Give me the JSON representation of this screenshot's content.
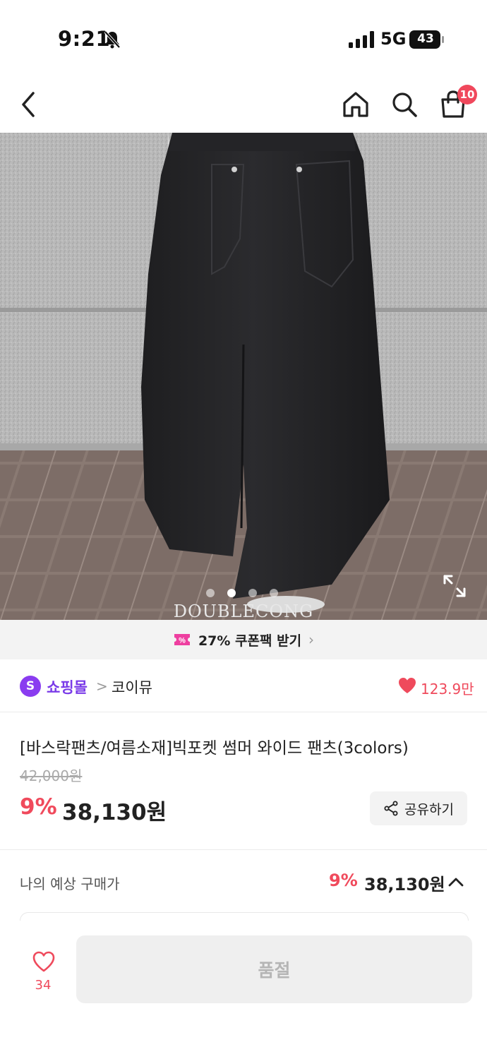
{
  "status_bar": {
    "time": "9:21",
    "network": "5G",
    "battery": "43"
  },
  "nav": {
    "cart_badge": "10"
  },
  "icons": {
    "back": "chevron-left-icon",
    "home": "home-icon",
    "search": "search-icon",
    "cart": "shopping-bag-icon",
    "share": "share-icon",
    "heart": "heart-icon",
    "expand": "expand-icon",
    "coupon": "coupon-icon"
  },
  "image": {
    "watermark": "DOUBLECONG",
    "slide_count": 4,
    "active_slide": 1
  },
  "coupon": {
    "text": "27% 쿠폰팩 받기",
    "chevron": "›"
  },
  "store": {
    "logo_letter": "S",
    "name": "쇼핑몰",
    "separator": ">",
    "brand": "코이뮤",
    "likes": "123.9만"
  },
  "product": {
    "title": "[바스락팬츠/여름소재]빅포켓 썸머 와이드 팬츠(3colors)",
    "original_price": "42,000원",
    "discount_rate": "9%",
    "sale_price": "38,130원",
    "share_label": "공유하기"
  },
  "expected": {
    "label": "나의 예상 구매가",
    "rate": "9%",
    "price": "38,130원"
  },
  "bottom": {
    "wish_count": "34",
    "buy_label": "품절"
  },
  "colors": {
    "accent": "#f04a5c",
    "store_purple": "#7a3be8",
    "store_logo": "#8a3cf0",
    "disabled_bg": "#efefef"
  }
}
